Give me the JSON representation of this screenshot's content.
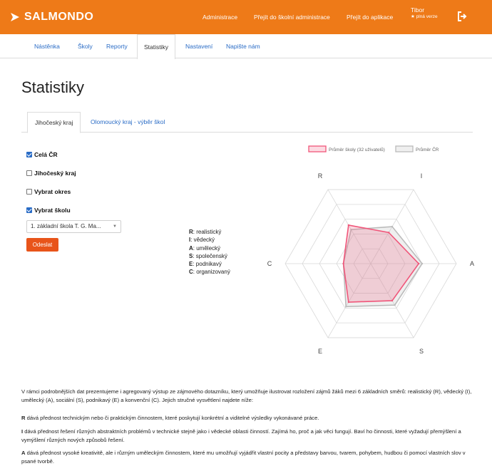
{
  "header": {
    "brand": "SALMONDO",
    "nav": [
      "Administrace",
      "Přejít do školní administrace",
      "Přejít do aplikace"
    ],
    "user_name": "Tibor",
    "user_sub": "★ plná verze",
    "colors": {
      "accent": "#ee7a18",
      "link": "#2a6cc6",
      "button": "#e8541a"
    }
  },
  "subnav": [
    "Nástěnka",
    "Školy",
    "Reporty",
    "Statistiky",
    "Nastavení",
    "Napište nám"
  ],
  "page_title": "Statistiky",
  "region_tabs": [
    "Jihočeský kraj",
    "Olomoucký kraj - výběr škol"
  ],
  "filters": {
    "cela_cr": {
      "label": "Celá ČR",
      "checked": true
    },
    "kraj": {
      "label": "Jihočeský kraj",
      "checked": false
    },
    "okres": {
      "label": "Vybrat okres",
      "checked": false
    },
    "skola": {
      "label": "Vybrat školu",
      "checked": true
    },
    "selected_school": "1. základní škola T. G. Ma...",
    "submit_label": "Odeslat"
  },
  "riasec_legend": [
    {
      "code": "R",
      "text": ": realistický"
    },
    {
      "code": "I",
      "text": ": vědecký"
    },
    {
      "code": "A",
      "text": ": umělecký"
    },
    {
      "code": "S",
      "text": ": společenský"
    },
    {
      "code": "E",
      "text": ": podnikavý"
    },
    {
      "code": "C",
      "text": ": organizovaný"
    }
  ],
  "chart_data": {
    "type": "radar",
    "axes": [
      "R",
      "I",
      "A",
      "S",
      "E",
      "C"
    ],
    "range": [
      0,
      5
    ],
    "series": [
      {
        "name": "Průměr školy (32 uživatelů)",
        "values": [
          2.6,
          2.1,
          2.8,
          2.5,
          2.6,
          1.6
        ],
        "color": "#f0567a"
      },
      {
        "name": "Průměr ČR",
        "values": [
          2.3,
          2.5,
          3.0,
          2.8,
          2.9,
          1.6
        ],
        "color": "#bbbbbb"
      }
    ],
    "legend": "top"
  },
  "text": {
    "intro": "V rámci podrobnějších dat prezentujeme i agregovaný výstup ze zájmového dotazníku, který umožňuje ilustrovat rozložení zájmů žáků mezi 6 základních směrů: realistický (R), vědecký (I), umělecký (A), sociální (S), podnikavý (E) a konvenční (C). Jejich stručné vysvětlení najdete níže:",
    "r_code": "R",
    "r": " dává přednost technickým nebo či praktickým činnostem, které poskytují konkrétní a viditelné výsledky vykonávané práce.",
    "i_code": "I",
    "i": " dává přednost řešení různých abstraktních problémů v technické stejně jako i vědecké oblasti činností. Zajímá ho, proč a jak věci fungují. Baví ho činnosti, které vyžadují přemýšlení a vymýšlení různých nových způsobů řešení.",
    "a_code": "A",
    "a": " dává přednost vysoké kreativitě, ale i různým uměleckým činnostem, které mu umožňují vyjádřit vlastní pocity a představy barvou, tvarem, pohybem, hudbou či pomocí vlastních slov v psané tvorbě."
  }
}
